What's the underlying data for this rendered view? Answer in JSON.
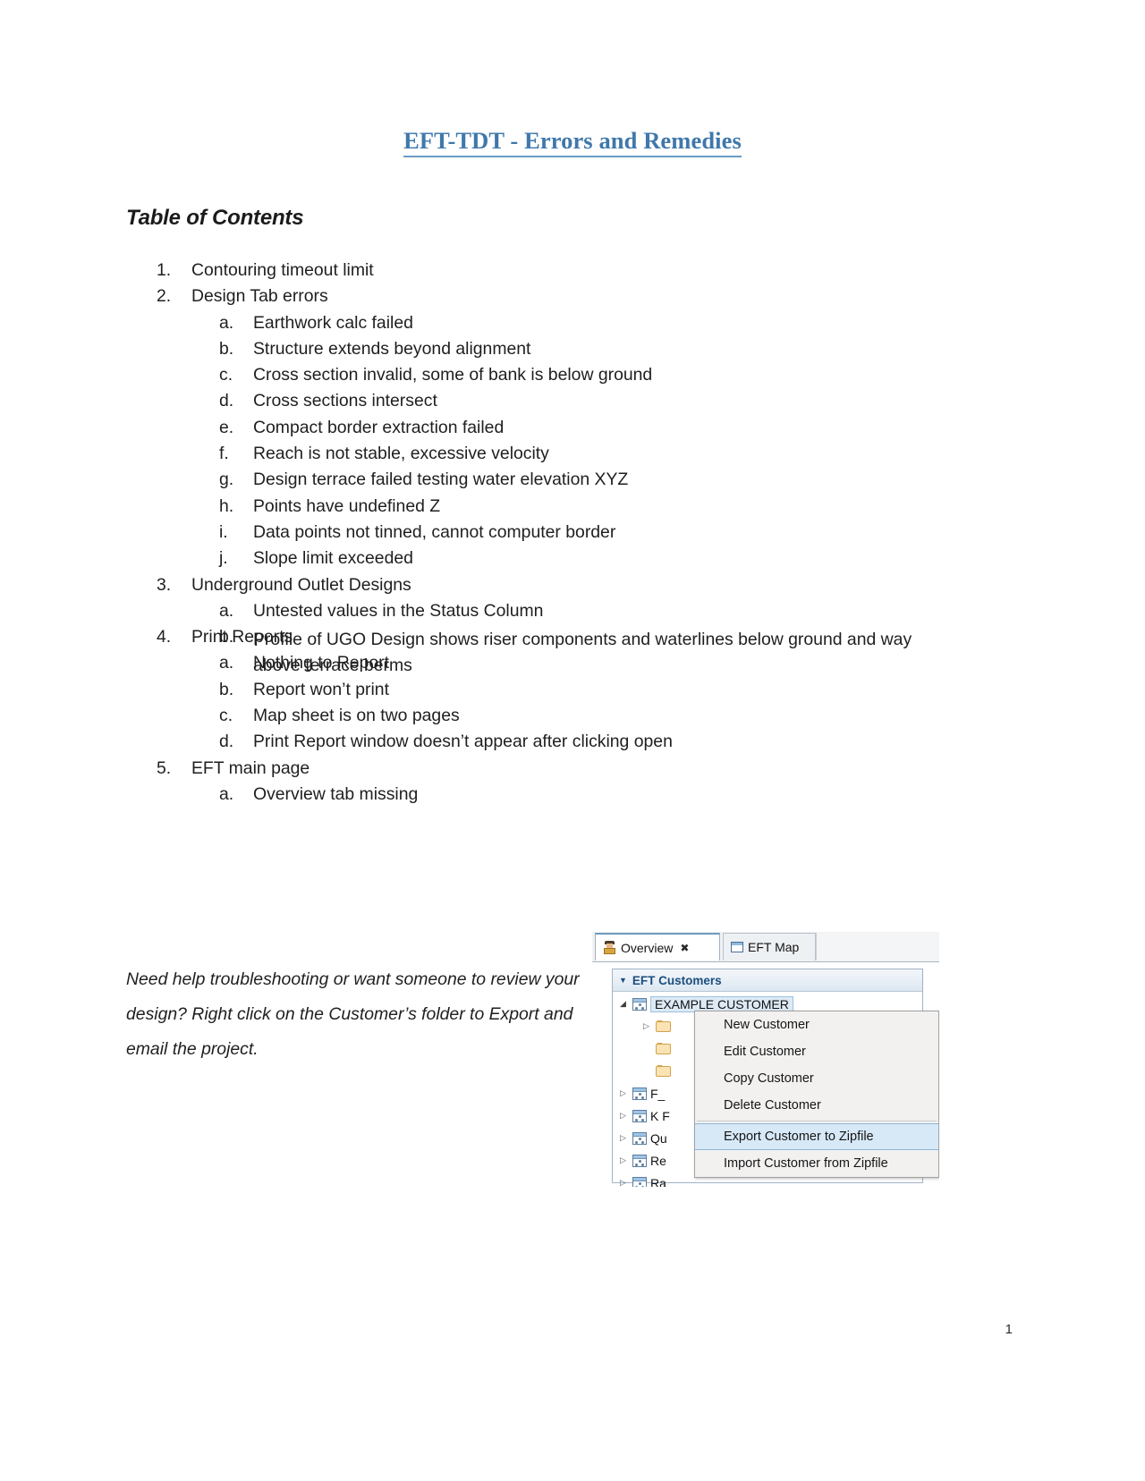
{
  "document": {
    "title": "EFT-TDT - Errors and Remedies",
    "toc_heading": "Table of Contents",
    "page_number": "1",
    "title_color": "#3f78ab",
    "note": "Need help troubleshooting or want someone to review your design?  Right click on the Customer’s folder to Export and email the project."
  },
  "toc": [
    {
      "level": 1,
      "marker": "1.",
      "text": "Contouring timeout limit"
    },
    {
      "level": 1,
      "marker": "2.",
      "text": "Design Tab errors"
    },
    {
      "level": 2,
      "marker": "a.",
      "text": "Earthwork calc failed"
    },
    {
      "level": 2,
      "marker": "b.",
      "text": "Structure extends beyond alignment"
    },
    {
      "level": 2,
      "marker": "c.",
      "text": "Cross section invalid, some of bank is below ground"
    },
    {
      "level": 2,
      "marker": "d.",
      "text": "Cross sections intersect"
    },
    {
      "level": 2,
      "marker": "e.",
      "text": "Compact border extraction failed"
    },
    {
      "level": 2,
      "marker": "f.",
      "text": "Reach is not stable, excessive velocity"
    },
    {
      "level": 2,
      "marker": "g.",
      "text": "Design terrace failed testing water elevation XYZ"
    },
    {
      "level": 2,
      "marker": "h.",
      "text": "Points have undefined Z"
    },
    {
      "level": 2,
      "marker": "i.",
      "text": "Data points not tinned, cannot computer border"
    },
    {
      "level": 2,
      "marker": "j.",
      "text": "Slope limit exceeded"
    },
    {
      "level": 1,
      "marker": "3.",
      "text": "Underground Outlet Designs"
    },
    {
      "level": 2,
      "marker": "a.",
      "text": "Untested values in the Status Column"
    },
    {
      "level": 2,
      "marker": "b.",
      "text": "Profile of UGO Design shows riser components and waterlines below ground and way above terrace berms",
      "wrap": true
    },
    {
      "level": 1,
      "marker": "4.",
      "text": "Print Reports"
    },
    {
      "level": 2,
      "marker": "a.",
      "text": "Nothing to Report"
    },
    {
      "level": 2,
      "marker": "b.",
      "text": "Report won’t print"
    },
    {
      "level": 2,
      "marker": "c.",
      "text": "Map sheet is on two pages"
    },
    {
      "level": 2,
      "marker": "d.",
      "text": "Print Report window doesn’t appear after clicking open"
    },
    {
      "level": 1,
      "marker": "5.",
      "text": "EFT main page"
    },
    {
      "level": 2,
      "marker": "a.",
      "text": "Overview tab missing"
    }
  ],
  "screenshot": {
    "tabs": [
      {
        "label": "Overview",
        "icon": "person-icon",
        "close": "✖",
        "active": true
      },
      {
        "label": "EFT Map",
        "icon": "map-window-icon",
        "active": false
      }
    ],
    "panel": {
      "caret": "▼",
      "title": "EFT Customers",
      "tree": [
        {
          "indent": "root",
          "twisty": "◢",
          "icon": "customer-icon",
          "label": "EXAMPLE CUSTOMER",
          "selected": true
        },
        {
          "indent": "child",
          "twisty": "▷",
          "icon": "folder-icon",
          "label": ""
        },
        {
          "indent": "child",
          "twisty": "",
          "icon": "folder-icon",
          "label": ""
        },
        {
          "indent": "child",
          "twisty": "",
          "icon": "folder-icon",
          "label": ""
        },
        {
          "indent": "sub",
          "twisty": "▷",
          "icon": "customer-icon",
          "label": "F_"
        },
        {
          "indent": "sub",
          "twisty": "▷",
          "icon": "customer-icon",
          "label": "K F"
        },
        {
          "indent": "sub",
          "twisty": "▷",
          "icon": "customer-icon",
          "label": "Qu"
        },
        {
          "indent": "sub",
          "twisty": "▷",
          "icon": "customer-icon",
          "label": "Re"
        },
        {
          "indent": "sub",
          "twisty": "▷",
          "icon": "customer-icon",
          "label": "Ra"
        }
      ]
    },
    "context_menu": {
      "items": [
        {
          "label": "New Customer",
          "highlight": false
        },
        {
          "label": "Edit Customer",
          "highlight": false
        },
        {
          "label": "Copy Customer",
          "highlight": false
        },
        {
          "label": "Delete Customer",
          "highlight": false
        },
        {
          "label": "Export Customer to Zipfile",
          "highlight": true
        },
        {
          "label": "Import Customer from Zipfile",
          "highlight": false
        }
      ],
      "highlight_color": "#d7e9f7"
    }
  }
}
